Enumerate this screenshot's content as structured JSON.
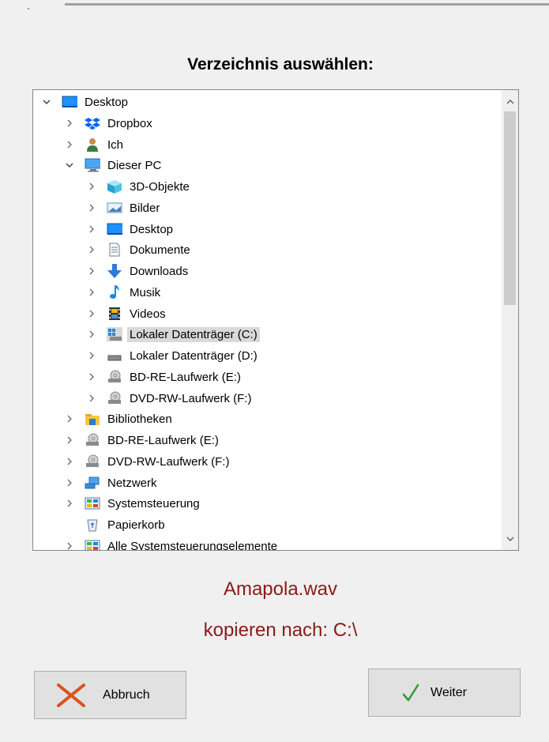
{
  "dialog": {
    "title": "Verzeichnis auswählen:",
    "message_file": "Amapola.wav",
    "message_target": "kopieren nach: C:\\"
  },
  "tree": {
    "items": [
      {
        "label": "Desktop",
        "icon": "desktop-icon",
        "expanded": true
      },
      {
        "label": "Dropbox",
        "icon": "dropbox-icon"
      },
      {
        "label": "Ich",
        "icon": "user-icon"
      },
      {
        "label": "Dieser PC",
        "icon": "computer-icon",
        "expanded": true
      },
      {
        "label": "3D-Objekte",
        "icon": "3d-objects-icon"
      },
      {
        "label": "Bilder",
        "icon": "pictures-icon"
      },
      {
        "label": "Desktop",
        "icon": "desktop-icon"
      },
      {
        "label": "Dokumente",
        "icon": "documents-icon"
      },
      {
        "label": "Downloads",
        "icon": "downloads-icon"
      },
      {
        "label": "Musik",
        "icon": "music-icon"
      },
      {
        "label": "Videos",
        "icon": "videos-icon"
      },
      {
        "label": "Lokaler Datenträger (C:)",
        "icon": "windows-drive-icon",
        "selected": true
      },
      {
        "label": "Lokaler Datenträger (D:)",
        "icon": "drive-icon"
      },
      {
        "label": "BD-RE-Laufwerk (E:)",
        "icon": "optical-drive-icon"
      },
      {
        "label": "DVD-RW-Laufwerk (F:)",
        "icon": "optical-drive-icon"
      },
      {
        "label": "Bibliotheken",
        "icon": "libraries-icon"
      },
      {
        "label": "BD-RE-Laufwerk (E:)",
        "icon": "optical-drive-icon"
      },
      {
        "label": "DVD-RW-Laufwerk (F:)",
        "icon": "optical-drive-icon"
      },
      {
        "label": "Netzwerk",
        "icon": "network-icon"
      },
      {
        "label": "Systemsteuerung",
        "icon": "control-panel-icon"
      },
      {
        "label": "Papierkorb",
        "icon": "recycle-bin-icon"
      },
      {
        "label": "Alle Systemsteuerungselemente",
        "icon": "control-panel-icon"
      }
    ]
  },
  "buttons": {
    "cancel_label": "Abbruch",
    "next_label": "Weiter"
  },
  "colors": {
    "message": "#8b1a1a",
    "selection": "#d9d9d9",
    "check": "#2e9e2e",
    "cross": "#d9531e"
  }
}
